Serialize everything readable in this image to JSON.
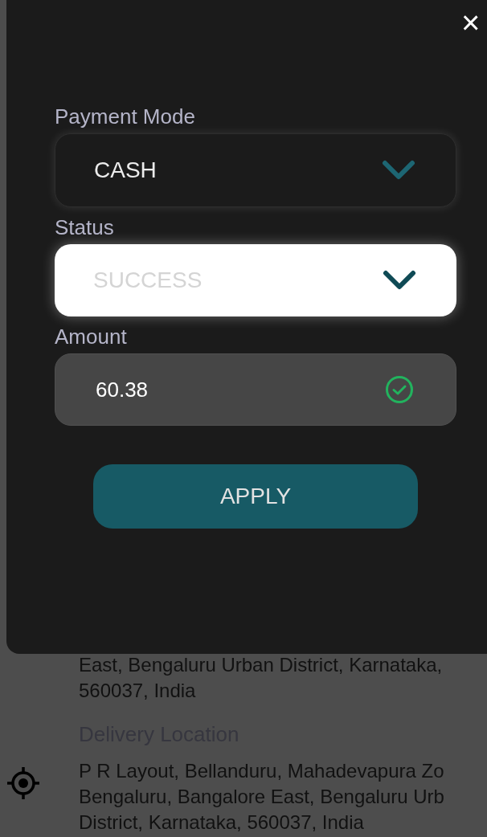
{
  "background": {
    "address_lines": [
      "East, Bengaluru Urban District, Karnataka,",
      "560037, India"
    ],
    "delivery_location": {
      "label": "Delivery Location",
      "lines": [
        "P R Layout, Bellanduru, Mahadevapura Zo",
        "Bengaluru, Bangalore East, Bengaluru Urb",
        "District, Karnataka, 560037, India"
      ]
    }
  },
  "sheet": {
    "close": "×",
    "fields": [
      {
        "kind": "dropdown",
        "label": "Payment Mode",
        "value": "CASH",
        "focused": false
      },
      {
        "kind": "dropdown",
        "label": "Status",
        "placeholder": "SUCCESS",
        "focused": true
      },
      {
        "kind": "input",
        "label": "Amount",
        "value": "60.38",
        "valid": true
      }
    ],
    "apply_button": "APPLY"
  }
}
